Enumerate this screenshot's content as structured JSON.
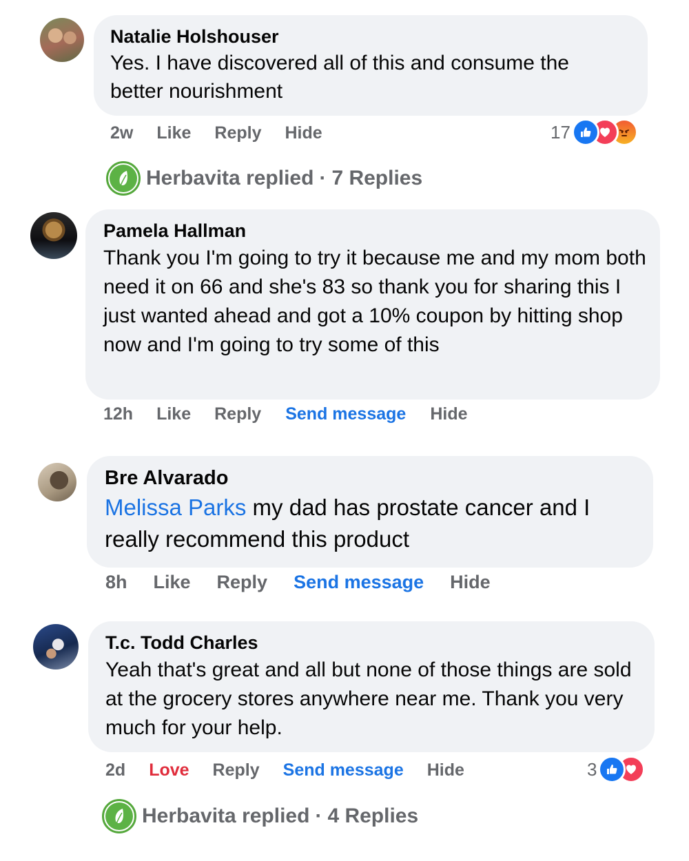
{
  "comments": [
    {
      "author": "Natalie Holshouser",
      "text": "Yes. I have discovered all of this and consume the better nourishment",
      "time": "2w",
      "like": "Like",
      "reply": "Reply",
      "hide": "Hide",
      "reaction_count": "17",
      "reaction_icons": [
        "like-icon",
        "heart-icon",
        "angry-icon"
      ],
      "replies_summary": {
        "page": "Herbavita replied",
        "dot": "·",
        "count": "7 Replies"
      }
    },
    {
      "author": "Pamela Hallman",
      "text": "Thank you I'm going to try it because me and my mom both need it on 66 and she's 83 so thank you for sharing this I just wanted ahead and got a 10% coupon by hitting shop now and I'm going to try some of this",
      "time": "12h",
      "like": "Like",
      "reply": "Reply",
      "send_message": "Send message",
      "hide": "Hide"
    },
    {
      "author": "Bre Alvarado",
      "mention": "Melissa Parks",
      "text": " my dad has prostate cancer and I really recommend this product",
      "time": "8h",
      "like": "Like",
      "reply": "Reply",
      "send_message": "Send message",
      "hide": "Hide"
    },
    {
      "author": "T.c. Todd Charles",
      "text": "Yeah that's great and all but none of those things are sold at the grocery stores anywhere near me. Thank you very much for your help.",
      "time": "2d",
      "love": "Love",
      "reply": "Reply",
      "send_message": "Send message",
      "hide": "Hide",
      "reaction_count": "3",
      "reaction_icons": [
        "like-icon",
        "heart-icon"
      ],
      "replies_summary": {
        "page": "Herbavita replied",
        "dot": "·",
        "count": "4 Replies"
      }
    }
  ],
  "colors": {
    "bubble": "#f0f2f5",
    "meta_gray": "#65676b",
    "link_blue": "#1b74e4",
    "love_red": "#e02d3c",
    "brand_green": "#5cb245"
  }
}
